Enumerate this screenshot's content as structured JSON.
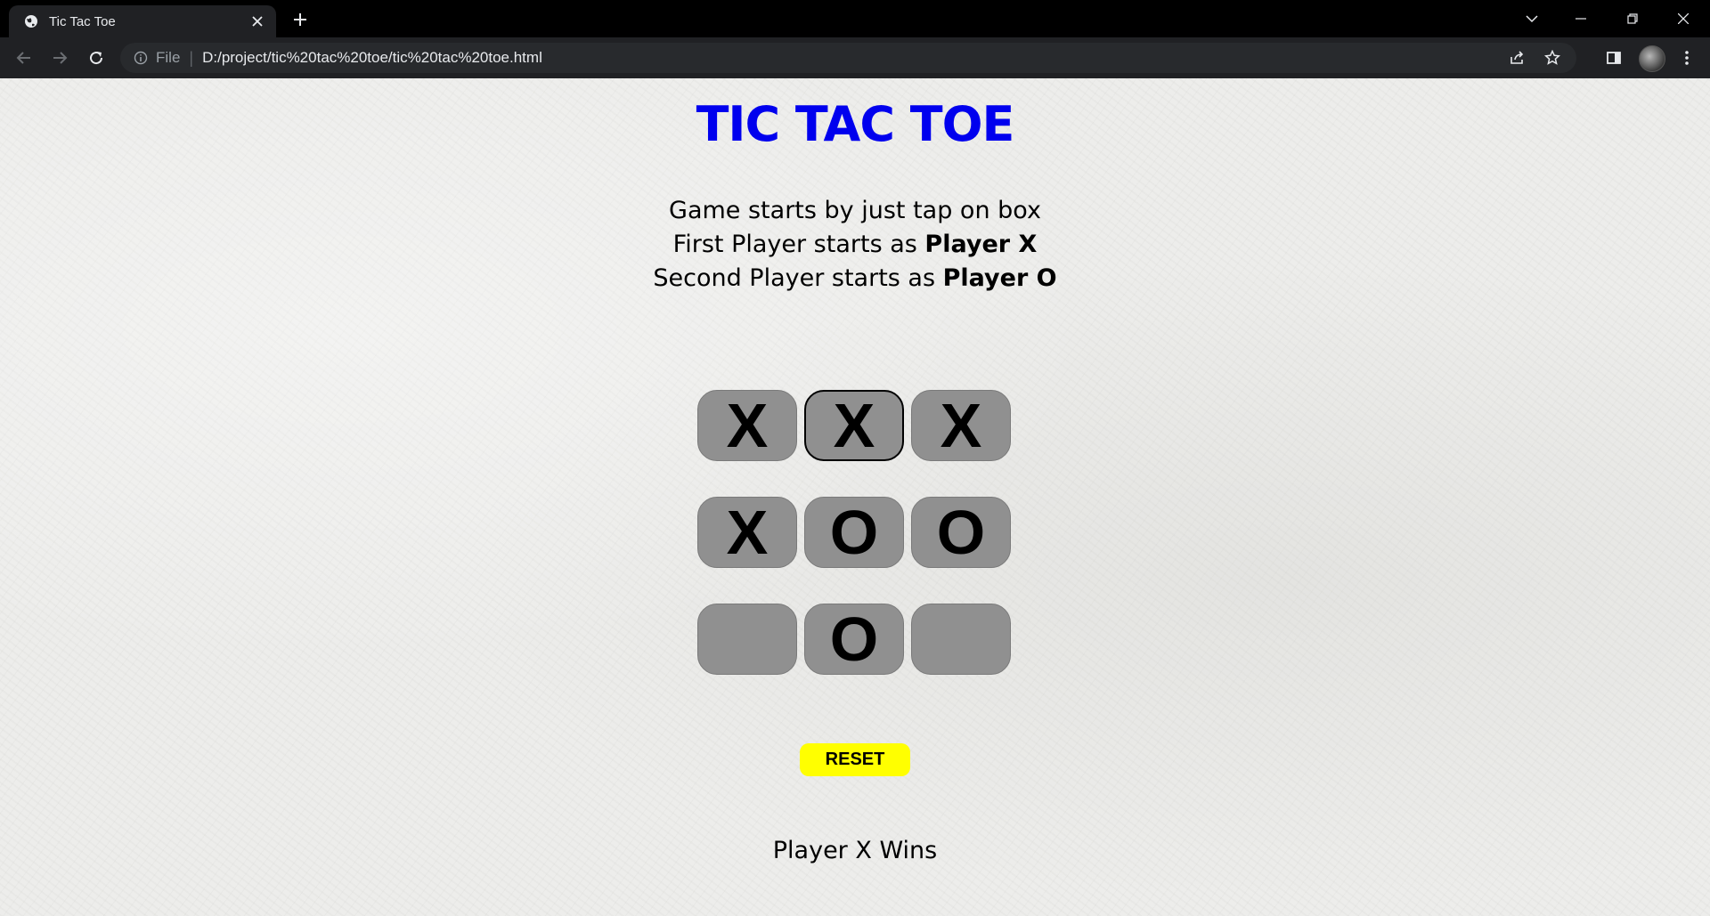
{
  "browser": {
    "tab_title": "Tic Tac Toe",
    "url_scheme_label": "File",
    "url": "D:/project/tic%20tac%20toe/tic%20tac%20toe.html"
  },
  "page": {
    "title": "TIC TAC TOE",
    "instructions": {
      "line1": "Game starts by just tap on box",
      "line2_prefix": "First Player starts as ",
      "line2_bold": "Player X",
      "line3_prefix": "Second Player starts as ",
      "line3_bold": "Player O"
    },
    "board": {
      "cells": [
        [
          "X",
          "X",
          "X"
        ],
        [
          "X",
          "O",
          "O"
        ],
        [
          "",
          "O",
          ""
        ]
      ],
      "active_cell": [
        0,
        1
      ]
    },
    "reset_label": "RESET",
    "result": "Player X Wins"
  },
  "colors": {
    "title": "#0000ee",
    "cell": "#909090",
    "reset": "#ffff00"
  }
}
